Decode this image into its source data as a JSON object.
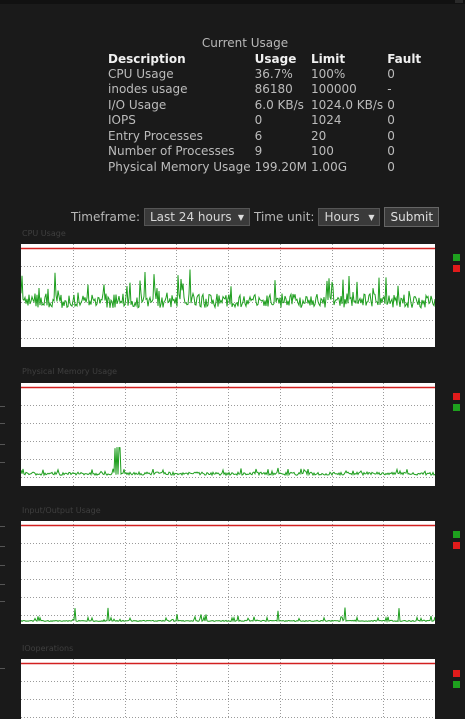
{
  "usage": {
    "title": "Current Usage",
    "headers": [
      "Description",
      "Usage",
      "Limit",
      "Fault"
    ],
    "rows": [
      [
        "CPU Usage",
        "36.7%",
        "100%",
        "0"
      ],
      [
        "inodes usage",
        "86180",
        "100000",
        "-"
      ],
      [
        "I/O Usage",
        "6.0 KB/s",
        "1024.0 KB/s",
        "0"
      ],
      [
        "IOPS",
        "0",
        "1024",
        "0"
      ],
      [
        "Entry Processes",
        "6",
        "20",
        "0"
      ],
      [
        "Number of Processes",
        "9",
        "100",
        "0"
      ],
      [
        "Physical Memory Usage",
        "199.20M",
        "1.00G",
        "0"
      ]
    ]
  },
  "controls": {
    "timeframe_label": "Timeframe:",
    "timeframe_value": "Last 24 hours",
    "timeunit_label": "Time unit:",
    "timeunit_value": "Hours",
    "submit_label": "Submit"
  },
  "charts": {
    "cpu": {
      "title": "CPU Usage"
    },
    "memory": {
      "title": "Physical Memory Usage"
    },
    "io": {
      "title": "Input/Output Usage"
    },
    "iops": {
      "title": "IOoperations"
    }
  },
  "colors": {
    "limit_line": "#d22020",
    "usage_line": "#1e9e1e",
    "legend_green": "#1ea01e",
    "legend_red": "#e01b1b"
  },
  "chart_data": [
    {
      "type": "line",
      "title": "CPU Usage",
      "series": [],
      "grid": true
    },
    {
      "type": "line",
      "title": "Physical Memory Usage",
      "series": [],
      "grid": true
    },
    {
      "type": "line",
      "title": "Input/Output Usage",
      "series": [],
      "grid": true
    },
    {
      "type": "line",
      "title": "IOoperations",
      "series": [],
      "grid": true
    }
  ]
}
